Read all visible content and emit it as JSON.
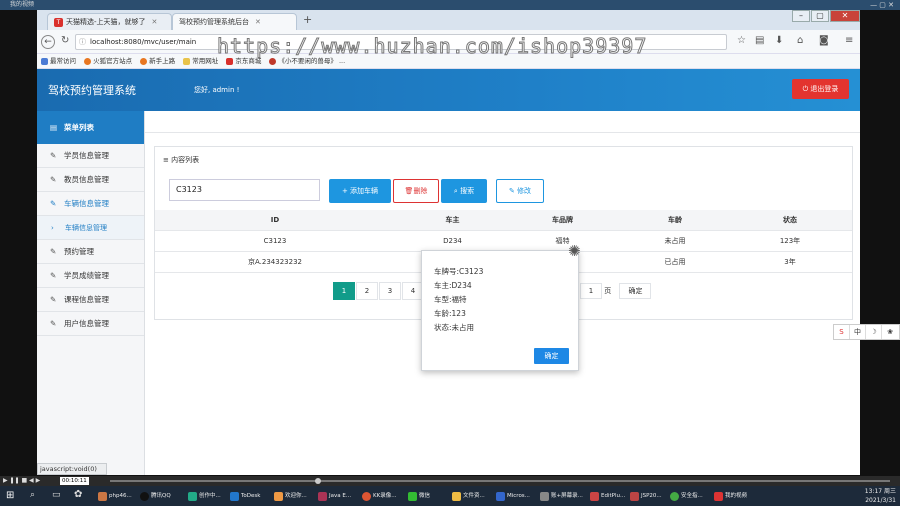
{
  "window": {
    "title": "我的视频"
  },
  "browser": {
    "tabs": [
      {
        "label": "天猫精选-上天猫，就够了"
      },
      {
        "label": "驾校预约管理系统后台"
      }
    ],
    "url": "localhost:8080/mvc/user/main",
    "watermark": "https://www.huzhan.com/ishop39397",
    "bookmarks": [
      "最常访问",
      "火狐官方站点",
      "新手上路",
      "常用网址",
      "京东商城",
      "《小不要闲的兽母》 ..."
    ],
    "status_text": "javascript:void(0)"
  },
  "app": {
    "title": "驾校预约管理系统",
    "greeting": "您好, admin !",
    "logout_label": "退出登录"
  },
  "sidebar": {
    "header": "菜单列表",
    "items": [
      {
        "label": "学员信息管理"
      },
      {
        "label": "教员信息管理"
      },
      {
        "label": "车辆信息管理"
      },
      {
        "label": "车辆信息管理"
      },
      {
        "label": "预约管理"
      },
      {
        "label": "学员成绩管理"
      },
      {
        "label": "课程信息管理"
      },
      {
        "label": "用户信息管理"
      }
    ]
  },
  "panel": {
    "title": "内容列表",
    "search_value": "C3123",
    "buttons": {
      "add": "+ 添加车辆",
      "delete": "删除",
      "search": "搜索",
      "edit": "修改"
    }
  },
  "table": {
    "headers": [
      "ID",
      "车主",
      "车品牌",
      "车龄",
      "状态"
    ],
    "rows": [
      [
        "C3123",
        "D234",
        "福特",
        "未占用",
        "123年"
      ],
      [
        "京A.234323232",
        "",
        "",
        "已占用",
        "3年"
      ]
    ]
  },
  "pagination": {
    "pages": [
      "1",
      "2",
      "3",
      "4"
    ],
    "current": "1",
    "goto_value": "1",
    "page_unit": "页",
    "confirm": "确定"
  },
  "popup": {
    "lines": [
      "车牌号:C3123",
      "车主:D234",
      "车型:福特",
      "车龄:123",
      "状态:未占用"
    ],
    "ok": "确定"
  },
  "ime": {
    "items": [
      "中",
      "☽",
      "❀"
    ]
  },
  "player": {
    "time": "00:10:11"
  },
  "taskbar": {
    "items": [
      "php46...",
      "腾讯QQ",
      "创作中...",
      "ToDesk",
      "欢迎你...",
      "Java E...",
      "KK录像...",
      "微信",
      "文件资...",
      "Micros...",
      "账+屏幕录...",
      "EditPlu...",
      "JSP20...",
      "安全指...",
      "我的视频"
    ],
    "clock": "13:17 周三",
    "date": "2021/3/31"
  }
}
